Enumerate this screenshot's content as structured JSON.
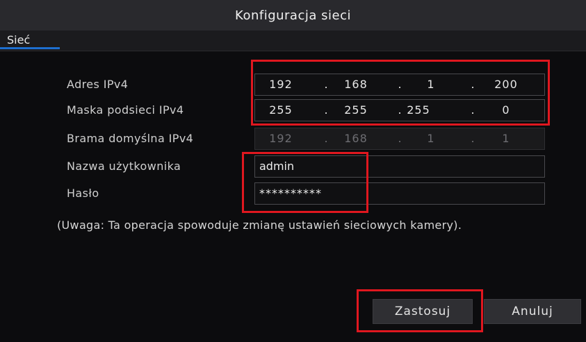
{
  "dialog": {
    "title": "Konfiguracja sieci"
  },
  "tabs": [
    {
      "label": "Sieć"
    }
  ],
  "form": {
    "ipv4_address": {
      "label": "Adres IPv4",
      "octets": [
        "192",
        "168",
        "1",
        "200"
      ]
    },
    "subnet_mask": {
      "label": "Maska podsieci IPv4",
      "octets": [
        "255",
        "255",
        "255",
        "0"
      ]
    },
    "default_gateway": {
      "label": "Brama domyślna IPv4",
      "octets": [
        "192",
        "168",
        "1",
        "1"
      ]
    },
    "username": {
      "label": "Nazwa użytkownika",
      "value": "admin"
    },
    "password": {
      "label": "Hasło",
      "value": "**********"
    },
    "note": "(Uwaga: Ta operacja spowoduje zmianę ustawień sieciowych kamery)."
  },
  "buttons": {
    "apply": "Zastosuj",
    "cancel": "Anuluj"
  },
  "colors": {
    "accent": "#1e6fd0",
    "highlight": "#e0171f"
  }
}
